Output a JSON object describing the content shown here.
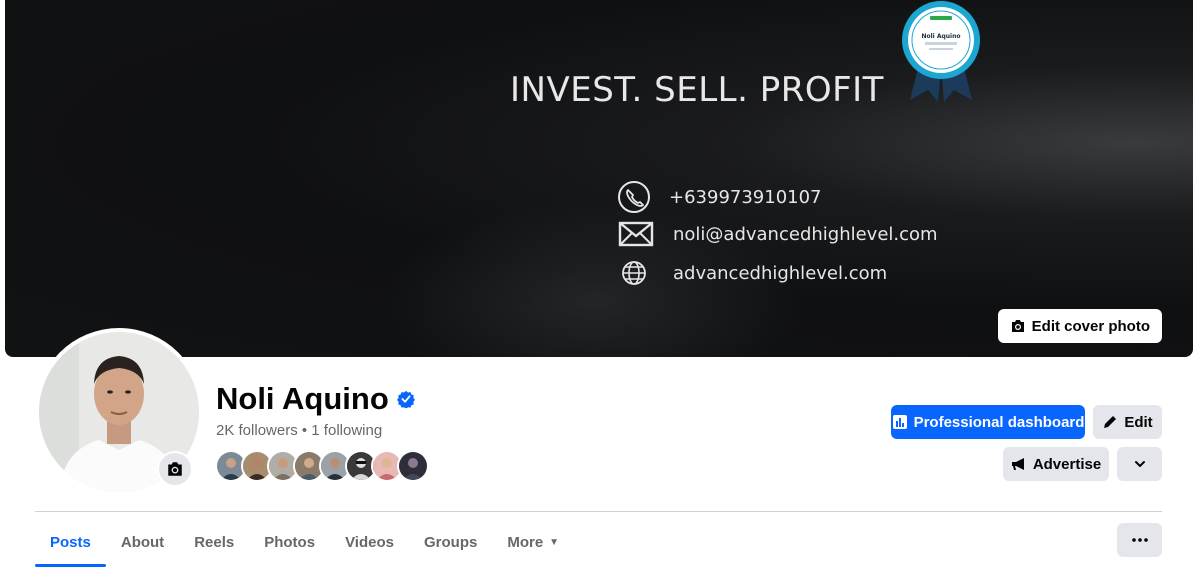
{
  "cover": {
    "headline": "INVEST. SELL. PROFIT",
    "phone": "+639973910107",
    "email": "noli@advancedhighlevel.com",
    "website": "advancedhighlevel.com",
    "badge_brand": "HighLevel",
    "badge_name": "Noli Aquino",
    "badge_title": "CERTIFIED ADMIN",
    "edit_cover_label": "Edit cover photo"
  },
  "profile": {
    "name": "Noli Aquino",
    "followers": "2K followers",
    "separator": " • ",
    "following": "1 following",
    "verified_icon": "verified-badge-icon",
    "friend_avatar_count": 8
  },
  "actions": {
    "professional_dashboard": "Professional dashboard",
    "edit": "Edit",
    "advertise": "Advertise"
  },
  "tabs": [
    {
      "label": "Posts",
      "active": true
    },
    {
      "label": "About"
    },
    {
      "label": "Reels"
    },
    {
      "label": "Photos"
    },
    {
      "label": "Videos"
    },
    {
      "label": "Groups"
    },
    {
      "label": "More"
    }
  ],
  "colors": {
    "accent": "#0866ff",
    "button_gray": "#e4e6eb",
    "text_secondary": "#65676b"
  }
}
